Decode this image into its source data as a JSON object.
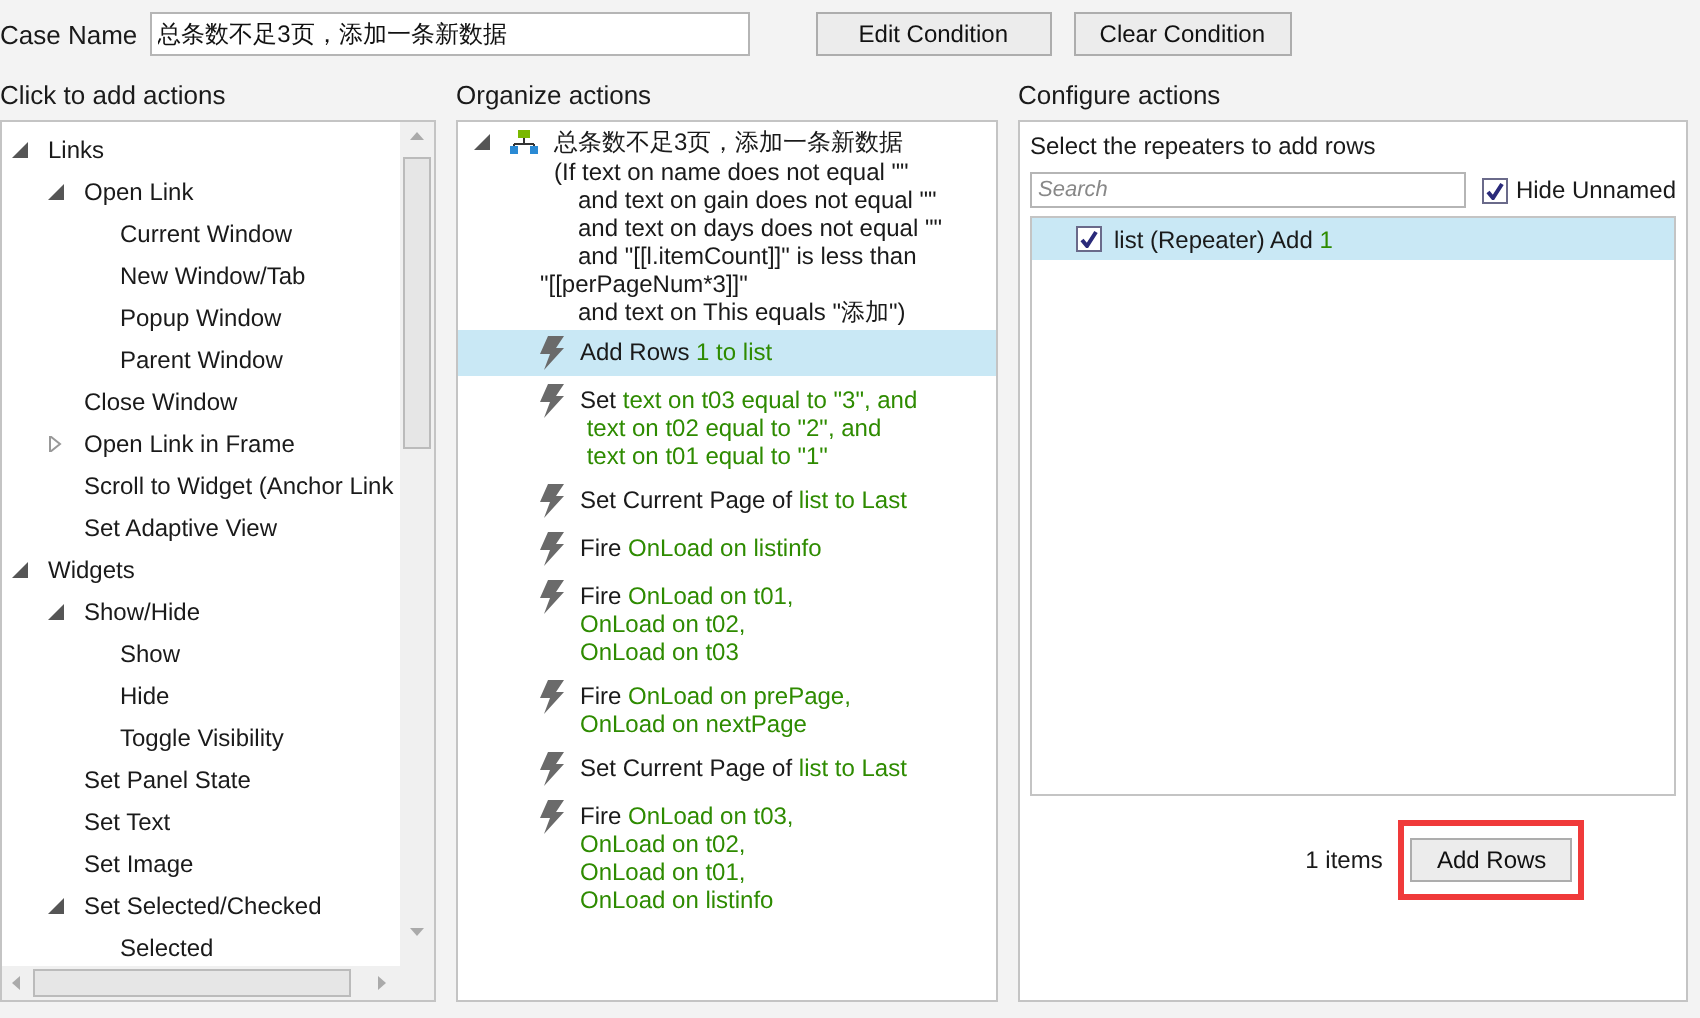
{
  "case_name": {
    "label": "Case Name",
    "value": "总条数不足3页，添加一条新数据"
  },
  "buttons": [
    "Edit Condition",
    "Clear Condition"
  ],
  "left": {
    "heading": "Click to add actions",
    "tree": [
      {
        "label": "Links",
        "expanded": true,
        "children": [
          {
            "label": "Open Link",
            "expanded": true,
            "children": [
              {
                "label": "Current Window"
              },
              {
                "label": "New Window/Tab"
              },
              {
                "label": "Popup Window"
              },
              {
                "label": "Parent Window"
              }
            ]
          },
          {
            "label": "Close Window"
          },
          {
            "label": "Open Link in Frame",
            "expanded": false
          },
          {
            "label": "Scroll to Widget (Anchor Link"
          },
          {
            "label": "Set Adaptive View"
          }
        ]
      },
      {
        "label": "Widgets",
        "expanded": true,
        "children": [
          {
            "label": "Show/Hide",
            "expanded": true,
            "children": [
              {
                "label": "Show"
              },
              {
                "label": "Hide"
              },
              {
                "label": "Toggle Visibility"
              }
            ]
          },
          {
            "label": "Set Panel State"
          },
          {
            "label": "Set Text"
          },
          {
            "label": "Set Image"
          },
          {
            "label": "Set Selected/Checked",
            "expanded": true,
            "children": [
              {
                "label": "Selected"
              }
            ]
          }
        ]
      }
    ]
  },
  "middle": {
    "heading": "Organize actions",
    "case": {
      "title": "总条数不足3页，添加一条新数据",
      "expanded": true,
      "condition": [
        {
          "kind": "open",
          "text": "(If text on name does not equal \"\""
        },
        {
          "kind": "and",
          "text": "and text on gain does not equal \"\""
        },
        {
          "kind": "and",
          "text": "and text on days does not equal \"\""
        },
        {
          "kind": "and",
          "text": "and \"[[l.itemCount]]\" is less than"
        },
        {
          "kind": "wrap",
          "text": "\"[[perPageNum*3]]\""
        },
        {
          "kind": "and",
          "text": "and text on This equals \"添加\")"
        }
      ]
    },
    "actions": [
      {
        "selected": true,
        "lines": [
          [
            {
              "text": "Add Rows",
              "value": false
            },
            {
              "text": "1 to list",
              "value": true
            }
          ]
        ]
      },
      {
        "selected": false,
        "lines": [
          [
            {
              "text": "Set",
              "value": false
            },
            {
              "text": "text on t03 equal to \"3\", and",
              "value": true
            }
          ],
          [
            {
              "text": " text on t02 equal to \"2\", and",
              "value": true
            }
          ],
          [
            {
              "text": " text on t01 equal to \"1\"",
              "value": true
            }
          ]
        ]
      },
      {
        "selected": false,
        "lines": [
          [
            {
              "text": "Set Current Page of",
              "value": false
            },
            {
              "text": "list to Last",
              "value": true
            }
          ]
        ]
      },
      {
        "selected": false,
        "lines": [
          [
            {
              "text": "Fire",
              "value": false
            },
            {
              "text": "OnLoad on listinfo",
              "value": true
            }
          ]
        ]
      },
      {
        "selected": false,
        "lines": [
          [
            {
              "text": "Fire",
              "value": false
            },
            {
              "text": "OnLoad on t01,",
              "value": true
            }
          ],
          [
            {
              "text": "OnLoad on t02,",
              "value": true
            }
          ],
          [
            {
              "text": "OnLoad on t03",
              "value": true
            }
          ]
        ]
      },
      {
        "selected": false,
        "lines": [
          [
            {
              "text": "Fire",
              "value": false
            },
            {
              "text": "OnLoad on prePage,",
              "value": true
            }
          ],
          [
            {
              "text": "OnLoad on nextPage",
              "value": true
            }
          ]
        ]
      },
      {
        "selected": false,
        "lines": [
          [
            {
              "text": "Set Current Page of",
              "value": false
            },
            {
              "text": "list to Last",
              "value": true
            }
          ]
        ]
      },
      {
        "selected": false,
        "lines": [
          [
            {
              "text": "Fire",
              "value": false
            },
            {
              "text": "OnLoad on t03,",
              "value": true
            }
          ],
          [
            {
              "text": "OnLoad on t02,",
              "value": true
            }
          ],
          [
            {
              "text": "OnLoad on t01,",
              "value": true
            }
          ],
          [
            {
              "text": "OnLoad on listinfo",
              "value": true
            }
          ]
        ]
      }
    ]
  },
  "right": {
    "heading": "Configure actions",
    "subheading": "Select the repeaters to add rows",
    "search": {
      "placeholder": "Search"
    },
    "hide_unnamed": {
      "label": "Hide Unnamed",
      "checked": true
    },
    "repeaters": [
      {
        "name": "list (Repeater) Add",
        "count": "1",
        "checked": true,
        "selected": true
      }
    ],
    "count": "1 items",
    "add_button": {
      "label": "Add Rows",
      "highlighted": true
    }
  }
}
